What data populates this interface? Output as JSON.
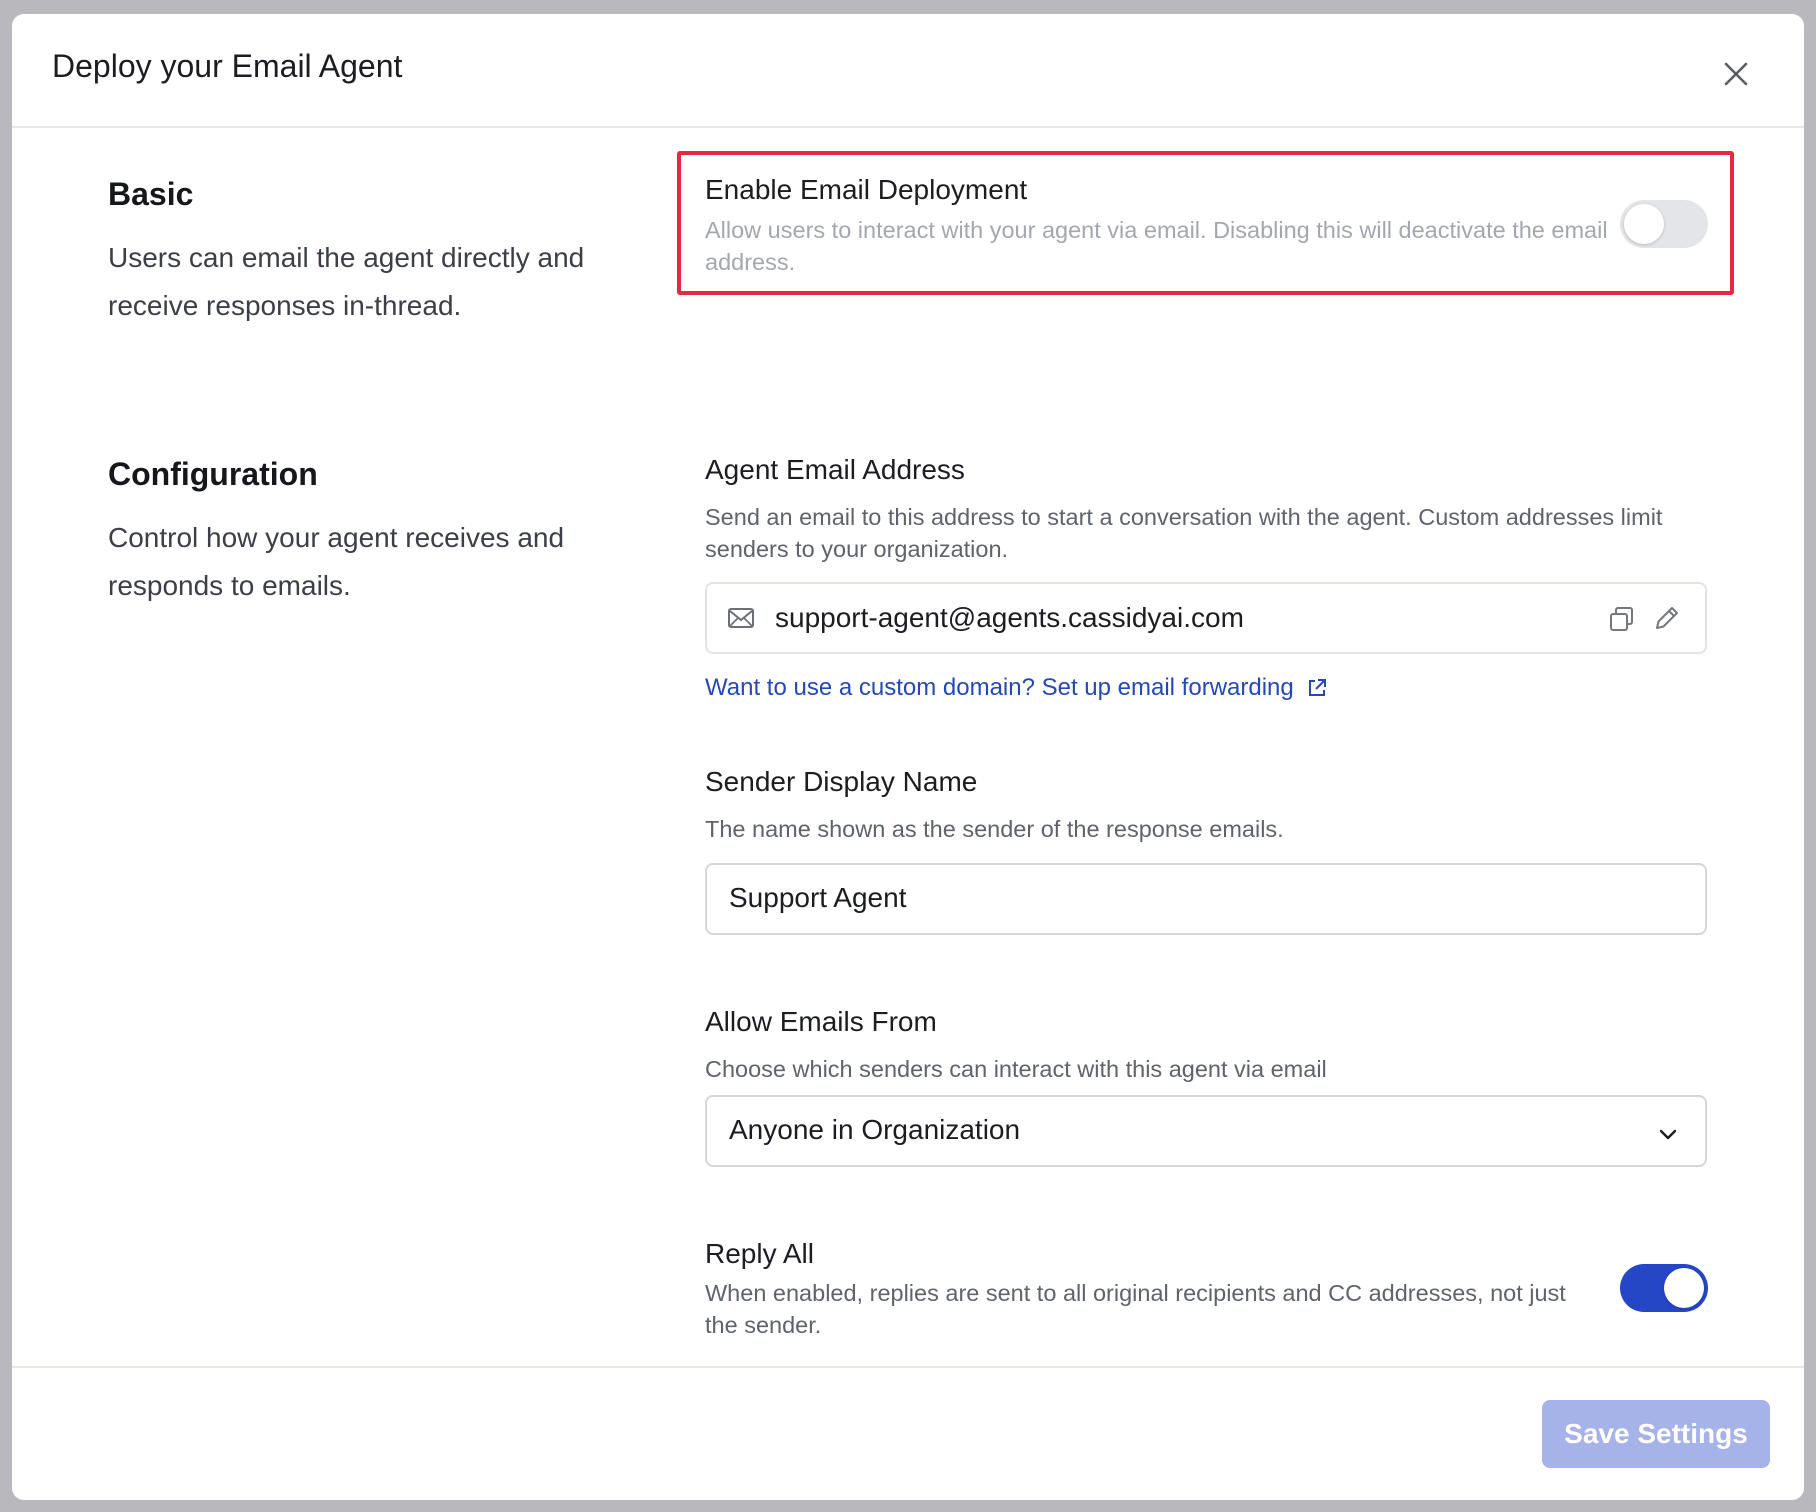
{
  "modal": {
    "title": "Deploy your Email Agent",
    "close_icon": "close-icon"
  },
  "basic": {
    "title": "Basic",
    "description": "Users can email the agent directly and receive responses in-thread.",
    "enable_deployment": {
      "label": "Enable Email Deployment",
      "help": "Allow users to interact with your agent via email. Disabling this will deactivate the email address.",
      "enabled": false
    }
  },
  "configuration": {
    "title": "Configuration",
    "description": "Control how your agent receives and responds to emails.",
    "agent_email": {
      "label": "Agent Email Address",
      "help": "Send an email to this address to start a conversation with the agent. Custom addresses limit senders to your organization.",
      "value": "support-agent@agents.cassidyai.com",
      "icons": [
        "mail-icon",
        "copy-icon",
        "edit-pencil-icon"
      ],
      "link": "Want to use a custom domain? Set up email forwarding",
      "link_icon": "external-link-icon"
    },
    "sender_name": {
      "label": "Sender Display Name",
      "help": "The name shown as the sender of the response emails.",
      "value": "Support Agent"
    },
    "allow_from": {
      "label": "Allow Emails From",
      "help": "Choose which senders can interact with this agent via email",
      "selected": "Anyone in Organization"
    },
    "reply_all": {
      "label": "Reply All",
      "help": "When enabled, replies are sent to all original recipients and CC addresses, not just the sender.",
      "enabled": true
    }
  },
  "footer": {
    "save_label": "Save Settings"
  },
  "colors": {
    "accent": "#2547c5",
    "highlight": "#e8283e",
    "save_disabled": "#a6b3e8",
    "link": "#2449b5"
  }
}
